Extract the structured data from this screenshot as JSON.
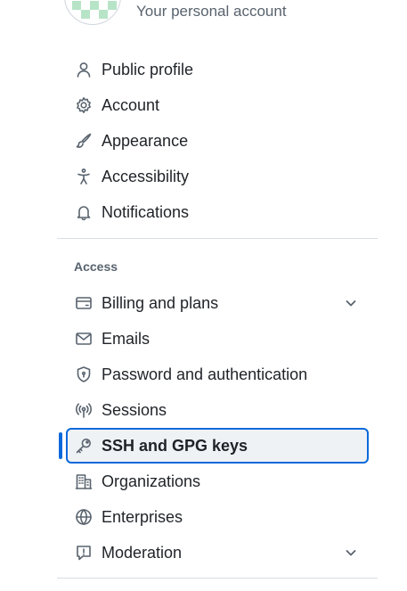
{
  "header": {
    "account_subtitle": "Your personal account"
  },
  "nav": {
    "primary_items": [
      {
        "label": "Public profile",
        "icon": "person-icon"
      },
      {
        "label": "Account",
        "icon": "gear-icon"
      },
      {
        "label": "Appearance",
        "icon": "paintbrush-icon"
      },
      {
        "label": "Accessibility",
        "icon": "accessibility-icon"
      },
      {
        "label": "Notifications",
        "icon": "bell-icon"
      }
    ],
    "access_heading": "Access",
    "access_items": [
      {
        "label": "Billing and plans",
        "icon": "credit-card-icon",
        "expandable": true
      },
      {
        "label": "Emails",
        "icon": "mail-icon"
      },
      {
        "label": "Password and authentication",
        "icon": "shield-lock-icon"
      },
      {
        "label": "Sessions",
        "icon": "broadcast-icon"
      },
      {
        "label": "SSH and GPG keys",
        "icon": "key-icon",
        "selected": true
      },
      {
        "label": "Organizations",
        "icon": "organization-icon"
      },
      {
        "label": "Enterprises",
        "icon": "globe-icon"
      },
      {
        "label": "Moderation",
        "icon": "report-icon",
        "expandable": true
      }
    ]
  },
  "colors": {
    "accent": "#0969da",
    "text": "#1f2328",
    "muted": "#59636e",
    "selected_bg": "#eff2f5",
    "border": "#d8dee4"
  }
}
